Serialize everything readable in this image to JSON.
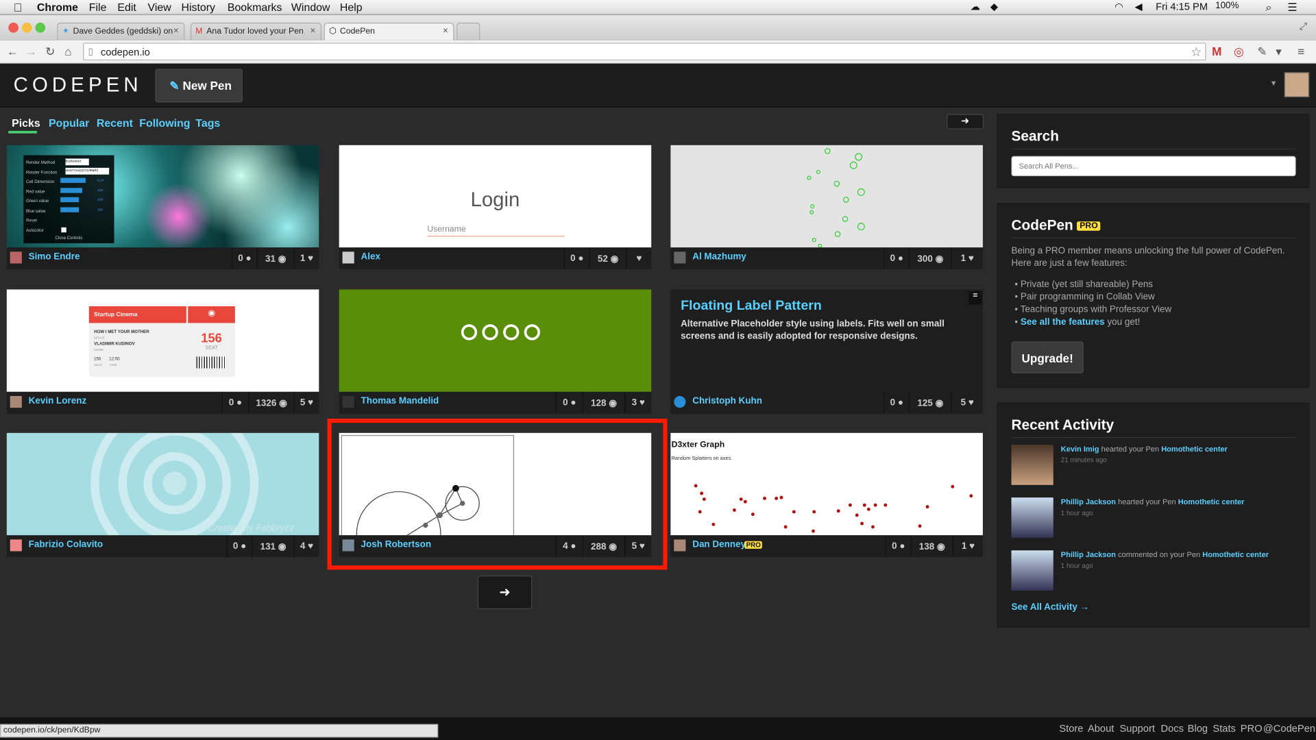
{
  "menubar": {
    "app": "Chrome",
    "items": [
      "File",
      "Edit",
      "View",
      "History",
      "Bookmarks",
      "Window",
      "Help"
    ],
    "clock": "Fri 4:15 PM",
    "battery": "100%"
  },
  "tabs": [
    {
      "label": "Dave Geddes (geddski) on"
    },
    {
      "label": "Ana Tudor loved your Pen"
    },
    {
      "label": "CodePen"
    }
  ],
  "address": "codepen.io",
  "status_url": "codepen.io/ck/pen/KdBpw",
  "header": {
    "logo": "CODEPEN",
    "new_pen": "New Pen"
  },
  "nav": [
    "Picks",
    "Popular",
    "Recent",
    "Following",
    "Tags"
  ],
  "cards": [
    {
      "author": "Simo Endre",
      "comments": "0",
      "views": "31",
      "hearts": "1"
    },
    {
      "author": "Alex",
      "comments": "0",
      "views": "52",
      "hearts": ""
    },
    {
      "author": "Al Mazhumy",
      "comments": "0",
      "views": "300",
      "hearts": "1"
    },
    {
      "author": "Kevin Lorenz",
      "comments": "0",
      "views": "1326",
      "hearts": "5"
    },
    {
      "author": "Thomas Mandelid",
      "comments": "0",
      "views": "128",
      "hearts": "3"
    },
    {
      "author": "Christoph Kuhn",
      "comments": "0",
      "views": "125",
      "hearts": "5"
    },
    {
      "author": "Fabrizio Colavito",
      "comments": "0",
      "views": "131",
      "hearts": "4"
    },
    {
      "author": "Josh Robertson",
      "comments": "4",
      "views": "288",
      "hearts": "5"
    },
    {
      "author": "Dan Denney",
      "comments": "0",
      "views": "138",
      "hearts": "1"
    }
  ],
  "thumbs": {
    "login_title": "Login",
    "login_placeholder": "Username",
    "cinema_brand": "Startup Cinema",
    "cinema_movie": "HOW I MET YOUR MOTHER",
    "cinema_movie_tag": "MOVIE",
    "cinema_name": "VLADIMIR KUDINOV",
    "cinema_name_tag": "NAME",
    "cinema_seat": "156",
    "cinema_seat_tag": "SEAT",
    "cinema_seat_small": "156",
    "cinema_time": "12:00",
    "cinema_seat_tag2": "SEAT",
    "cinema_time_tag": "TIME",
    "float_title": "Floating Label Pattern",
    "float_desc": "Alternative Placeholder style using labels. Fits well on small screens and is easily adopted for responsive designs.",
    "d3_title": "D3xter Graph",
    "d3_sub": "Random Splatters on axes.",
    "fab_watermark": "Created by Fabbryzz",
    "controls": [
      "Render Method",
      "Render Function",
      "Cell Dimension",
      "Red value",
      "Green value",
      "Blue value",
      "Reset",
      "Autocolor"
    ],
    "controls_close": "Close Controls",
    "controls_vals": [
      "bucketsort",
      "sin(2*cos(x))*(1/Math)"
    ],
    "controls_nums": [
      "0.14",
      "120",
      "150",
      "150"
    ]
  },
  "sidebar": {
    "search_title": "Search",
    "search_placeholder": "Search All Pens...",
    "pro_title": "CodePen",
    "pro_badge": "PRO",
    "pro_text": "Being a PRO member means unlocking the full power of CodePen. Here are just a few features:",
    "pro_list": [
      "Private (yet still shareable) Pens",
      "Pair programming in Collab View",
      "Teaching groups with Professor View"
    ],
    "pro_link": "See all the features",
    "pro_link_tail": "you get!",
    "upgrade": "Upgrade!",
    "activity_title": "Recent Activity",
    "activity": [
      {
        "user": "Kevin Imig",
        "action": "hearted your Pen",
        "pen": "Homothetic center",
        "time": "21 minutes ago"
      },
      {
        "user": "Phillip Jackson",
        "action": "hearted your Pen",
        "pen": "Homothetic center",
        "time": "1 hour ago"
      },
      {
        "user": "Phillip Jackson",
        "action": "commented on your Pen",
        "pen": "Homothetic center",
        "time": "1 hour ago"
      }
    ],
    "see_all": "See All Activity →"
  },
  "footer": [
    "Store",
    "About",
    "Support",
    "Docs",
    "Blog",
    "Stats",
    "PRO",
    "@CodePen"
  ],
  "colors": {
    "accent_green": "#47cf73",
    "link_blue": "#5ccfff",
    "highlight_red": "#ff1a00"
  }
}
